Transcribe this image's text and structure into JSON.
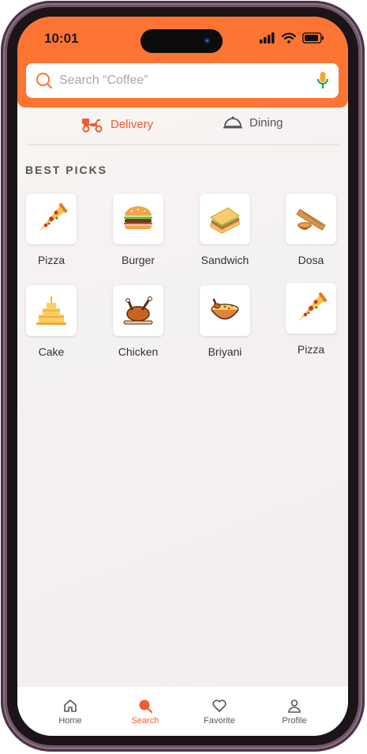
{
  "status": {
    "time": "10:01"
  },
  "search": {
    "placeholder": "Search “Coffee”"
  },
  "modes": [
    {
      "label": "Delivery",
      "active": true
    },
    {
      "label": "Dining",
      "active": false
    }
  ],
  "section_title": "BEST PICKS",
  "items": [
    {
      "label": "Pizza",
      "icon": "pizza-slice-icon"
    },
    {
      "label": "Burger",
      "icon": "burger-icon"
    },
    {
      "label": "Sandwich",
      "icon": "sandwich-icon"
    },
    {
      "label": "Dosa",
      "icon": "dosa-icon"
    },
    {
      "label": "Cake",
      "icon": "cake-icon"
    },
    {
      "label": "Chicken",
      "icon": "roast-chicken-icon"
    },
    {
      "label": "Briyani",
      "icon": "biryani-bowl-icon"
    },
    {
      "label": "Pizza",
      "icon": "pizza-slice-icon"
    }
  ],
  "tabs": [
    {
      "label": "Home",
      "icon": "home-icon",
      "active": false
    },
    {
      "label": "Search",
      "icon": "search-icon",
      "active": true
    },
    {
      "label": "Favorite",
      "icon": "heart-icon",
      "active": false
    },
    {
      "label": "Profile",
      "icon": "person-icon",
      "active": false
    }
  ],
  "colors": {
    "accent": "#fd7433",
    "active_text": "#f25a2f",
    "mic_green": "#1fa04a"
  }
}
